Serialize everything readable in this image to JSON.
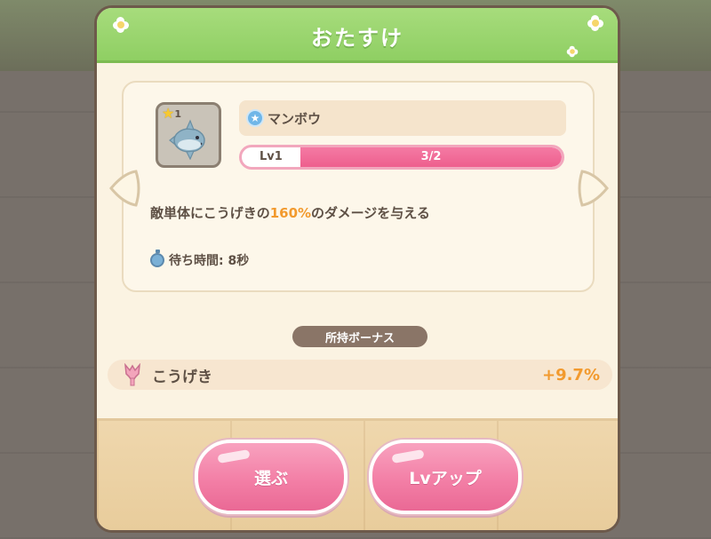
{
  "dialog": {
    "title": "おたすけ"
  },
  "helper": {
    "rarity": "1",
    "name": "マンボウ",
    "level_label": "Lv1",
    "progress_text": "3/2",
    "progress_fraction": 1.0,
    "description_before": "敵単体にこうげきの",
    "description_highlight": "160%",
    "description_after": "のダメージを与える",
    "wait_time": "待ち時間: 8秒"
  },
  "bonus": {
    "section_label": "所持ボーナス",
    "stat_label": "こうげき",
    "stat_value": "+9.7%"
  },
  "buttons": {
    "select_label": "選ぶ",
    "levelup_label": "Lvアップ"
  },
  "colors": {
    "header_green": "#9fd873",
    "accent_pink": "#f37fa6",
    "highlight_orange": "#f29a2e",
    "text_brown": "#5e5045"
  },
  "icons": {
    "rarity": "star-icon",
    "name_badge": "star-badge-icon",
    "wait": "timer-icon",
    "stat": "attack-icon",
    "nav_left": "arrow-left-icon",
    "nav_right": "arrow-right-icon"
  }
}
